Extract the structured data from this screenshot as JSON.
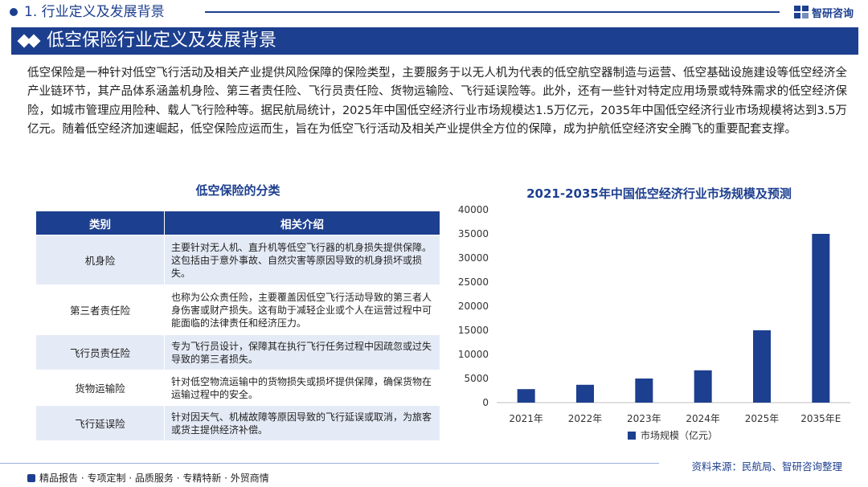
{
  "header": {
    "section_title": "1. 行业定义及发展背景",
    "logo_text": "智研咨询"
  },
  "banner": {
    "title": "低空保险行业定义及发展背景"
  },
  "intro": {
    "text": "低空保险是一种针对低空飞行活动及相关产业提供风险保障的保险类型，主要服务于以无人机为代表的低空航空器制造与运营、低空基础设施建设等低空经济全产业链环节，其产品体系涵盖机身险、第三者责任险、飞行员责任险、货物运输险、飞行延误险等。此外，还有一些针对特定应用场景或特殊需求的低空经济保险，如城市管理应用险种、载人飞行险种等。据民航局统计，2025年中国低空经济行业市场规模达1.5万亿元，2035年中国低空经济行业市场规模将达到3.5万亿元。随着低空经济加速崛起，低空保险应运而生，旨在为低空飞行活动及相关产业提供全方位的保障，成为护航低空经济安全腾飞的重要配套支撑。"
  },
  "table": {
    "title": "低空保险的分类",
    "headers": [
      "类别",
      "相关介绍"
    ],
    "rows": [
      {
        "name": "机身险",
        "desc": "主要针对无人机、直升机等低空飞行器的机身损失提供保障。这包括由于意外事故、自然灾害等原因导致的机身损坏或损失。"
      },
      {
        "name": "第三者责任险",
        "desc": "也称为公众责任险，主要覆盖因低空飞行活动导致的第三者人身伤害或财产损失。这有助于减轻企业或个人在运营过程中可能面临的法律责任和经济压力。"
      },
      {
        "name": "飞行员责任险",
        "desc": "专为飞行员设计，保障其在执行飞行任务过程中因疏忽或过失导致的第三者损失。"
      },
      {
        "name": "货物运输险",
        "desc": "针对低空物流运输中的货物损失或损坏提供保障，确保货物在运输过程中的安全。"
      },
      {
        "name": "飞行延误险",
        "desc": "针对因天气、机械故障等原因导致的飞行延误或取消，为旅客或货主提供经济补偿。"
      }
    ]
  },
  "chart_data": {
    "type": "bar",
    "title": "2021-2035年中国低空经济行业市场规模及预测",
    "categories": [
      "2021年",
      "2022年",
      "2023年",
      "2024年",
      "2025年",
      "2035年E"
    ],
    "series": [
      {
        "name": "市场规模（亿元）",
        "values": [
          2800,
          3700,
          5000,
          6700,
          15000,
          35000
        ]
      }
    ],
    "ylim": [
      0,
      40000
    ],
    "yticks": [
      "0",
      "5000",
      "10000",
      "15000",
      "20000",
      "25000",
      "30000",
      "35000",
      "40000"
    ],
    "grid": false,
    "legend_position": "bottom",
    "bar_color": "#1d3f8f"
  },
  "footer": {
    "left_text": "精品报告 · 专项定制 · 品质服务 · 专精特新 · 外贸商情",
    "source": "资料来源：民航局、智研咨询整理"
  }
}
